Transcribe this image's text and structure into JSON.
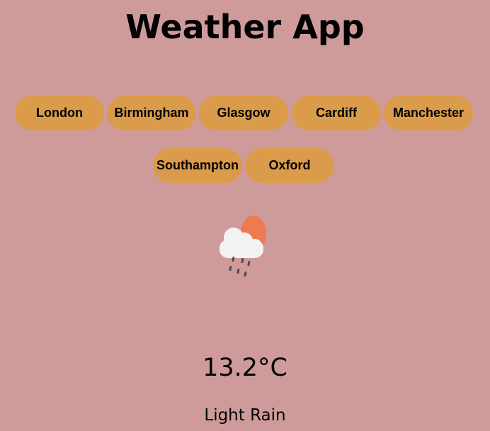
{
  "app": {
    "title": "Weather App"
  },
  "colors": {
    "background": "#cf9b9a",
    "button": "#da9b4a",
    "sun": "#ee7a4f",
    "cloud": "#f2f2f2",
    "rain": "#4c4c4c"
  },
  "cities": [
    {
      "label": "London"
    },
    {
      "label": "Birmingham"
    },
    {
      "label": "Glasgow"
    },
    {
      "label": "Cardiff"
    },
    {
      "label": "Manchester"
    },
    {
      "label": "Southampton"
    },
    {
      "label": "Oxford"
    }
  ],
  "weather": {
    "icon": "light-rain-icon",
    "temperature": "13.2°C",
    "condition": "Light Rain"
  }
}
